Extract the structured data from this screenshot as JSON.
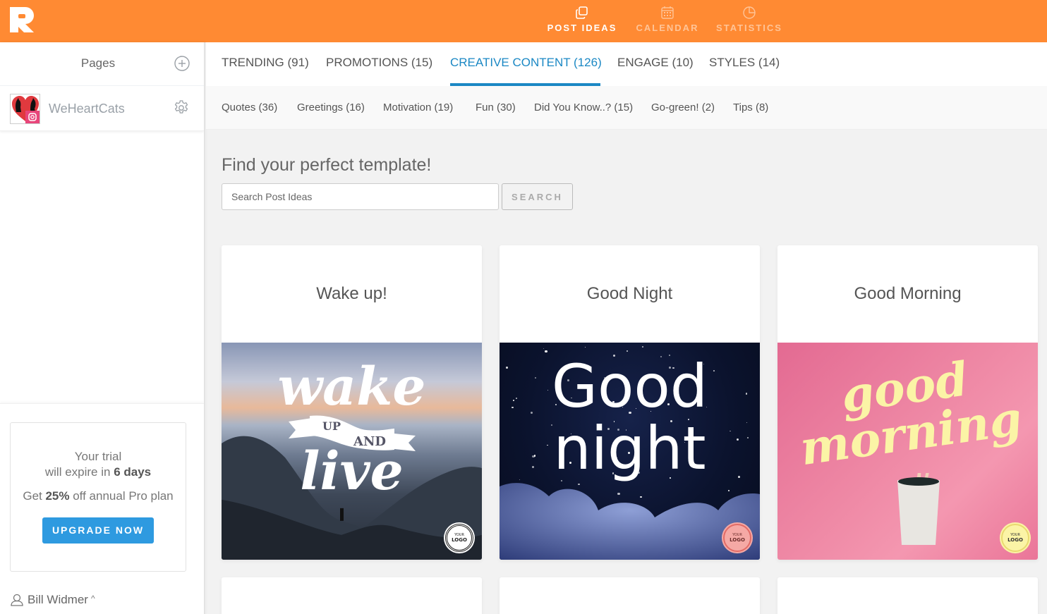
{
  "app": {
    "logo": "R-logo",
    "brand_color": "#ff8a33",
    "accent_color": "#1b88c4",
    "button_color": "#2e9ae0"
  },
  "topnav": [
    {
      "label": "POST IDEAS",
      "icon": "copy-icon",
      "active": true
    },
    {
      "label": "CALENDAR",
      "icon": "calendar-icon",
      "active": false
    },
    {
      "label": "STATISTICS",
      "icon": "pie-chart-icon",
      "active": false
    }
  ],
  "sidebar": {
    "pages_title": "Pages",
    "add_icon": "plus-circle-icon",
    "page": {
      "name": "WeHeartCats",
      "network": "instagram",
      "settings_icon": "gear-icon"
    },
    "trial": {
      "line1": "Your trial",
      "line2_prefix": "will expire in ",
      "line2_bold": "6 days",
      "line3_prefix": "Get ",
      "line3_bold": "25%",
      "line3_suffix": " off annual Pro plan",
      "button": "UPGRADE NOW"
    },
    "user": {
      "name": "Bill Widmer",
      "caret": "^"
    }
  },
  "tabs": [
    {
      "label": "TRENDING (91)",
      "active": false
    },
    {
      "label": "PROMOTIONS (15)",
      "active": false
    },
    {
      "label": "CREATIVE CONTENT (126)",
      "active": true
    },
    {
      "label": "ENGAGE (10)",
      "active": false
    },
    {
      "label": "STYLES (14)",
      "active": false
    }
  ],
  "subtabs": [
    {
      "label": "Quotes (36)"
    },
    {
      "label": "Greetings (16)"
    },
    {
      "label": "Motivation (19)"
    },
    {
      "label": "Fun (30)"
    },
    {
      "label": "Did You Know..? (15)"
    },
    {
      "label": "Go-green! (2)"
    },
    {
      "label": "Tips (8)"
    }
  ],
  "search": {
    "title": "Find your perfect template!",
    "placeholder": "Search Post Ideas",
    "value": "",
    "button": "SEARCH"
  },
  "cards": [
    {
      "title": "Wake up!",
      "image_text": [
        "wake",
        "UP AND",
        "live"
      ],
      "logo_text": [
        "YOUR",
        "LOGO"
      ]
    },
    {
      "title": "Good Night",
      "image_text": [
        "Good",
        "night"
      ],
      "logo_text": [
        "YOUR",
        "LOGO"
      ]
    },
    {
      "title": "Good Morning",
      "image_text": [
        "good",
        "morning"
      ],
      "logo_text": [
        "YOUR",
        "LOGO"
      ]
    },
    {
      "title": ""
    },
    {
      "title": ""
    },
    {
      "title": ""
    }
  ]
}
